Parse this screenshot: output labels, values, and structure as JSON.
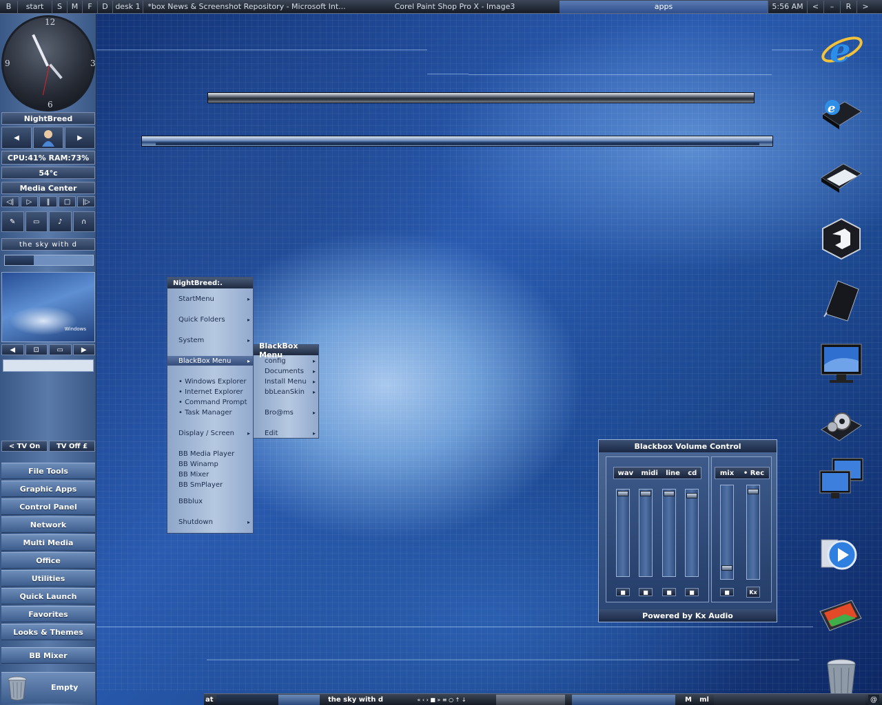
{
  "taskbar_top": {
    "buttons": [
      "B",
      "start",
      "S",
      "M",
      "F",
      "D"
    ],
    "workspace": "desk 1",
    "tasks": [
      {
        "label": "*box News & Screenshot Repository - Microsoft Int...",
        "active": false
      },
      {
        "label": "Corel Paint Shop Pro X - Image3",
        "active": false
      },
      {
        "label": "apps",
        "active": true
      }
    ],
    "clock": "5:56 AM",
    "controls": [
      "<",
      "–",
      "R",
      ">"
    ]
  },
  "sidebar": {
    "clock_numbers": {
      "twelve": "12",
      "three": "3",
      "six": "6",
      "nine": "9"
    },
    "user_name": "NightBreed",
    "stats": "CPU:41% RAM:73%",
    "temperature": "54°c",
    "media_center_title": "Media Center",
    "now_playing": "the sky with d",
    "progress_value": 0.33,
    "tv_on": "< TV On",
    "tv_off": "TV Off £",
    "nav_items": [
      "File Tools",
      "Graphic Apps",
      "Control Panel",
      "Network",
      "Multi Media",
      "Office",
      "Utilities",
      "Quick Launch",
      "Favorites",
      "Looks & Themes",
      "BB Mixer"
    ],
    "recycle_label": "Empty",
    "thumbnail_logo": "Windows"
  },
  "main_menu": {
    "title": "NightBreed:.",
    "items": {
      "startmenu": "StartMenu",
      "quick_folders": "Quick Folders",
      "system": "System",
      "blackbox_menu": "BlackBox Menu",
      "windows_explorer": "• Windows Explorer",
      "internet_explorer": "• Internet Explorer",
      "command_prompt": "• Command Prompt",
      "task_manager": "• Task Manager",
      "display_screen": "Display / Screen",
      "bb_media_player": "BB Media Player",
      "bb_winamp": "BB Winamp",
      "bb_mixer": "BB Mixer",
      "bb_smplayer": "BB SmPlayer",
      "bbblux": "BBblux",
      "shutdown": "Shutdown"
    }
  },
  "submenu": {
    "title": "BlackBox Menu",
    "items": {
      "config": "config",
      "documents": "Documents",
      "install_menu": "Install Menu",
      "bbleanskin": "bbLeanSkin",
      "broams": "Bro@ms",
      "edit": "Edit"
    }
  },
  "volume_control": {
    "title": "Blackbox Volume Control",
    "channels_left": [
      "wav",
      "midi",
      "line",
      "cd"
    ],
    "channels_right": [
      "mix",
      "• Rec"
    ],
    "levels": {
      "wav": 0.98,
      "midi": 0.98,
      "line": 0.98,
      "cd": 0.96,
      "mix": 0.08,
      "rec": 0.96
    },
    "footer": "Powered by Kx Audio",
    "kx_button": "Kx"
  },
  "taskbar_bottom": {
    "left_label": "at",
    "now_playing": "the sky with d",
    "media_controls": "« ‹ › ■ »  ≡ ○ ↑ ↓",
    "right_labels": [
      "M",
      "ml"
    ],
    "corner": "@"
  },
  "desktop_icons": [
    "internet-explorer-icon",
    "ie-folder-icon",
    "folder-icon",
    "box-app-icon",
    "notebook-icon",
    "monitor-icon",
    "settings-folder-icon",
    "network-monitors-icon",
    "media-player-icon",
    "image-viewer-icon",
    "recycle-bin-icon"
  ]
}
